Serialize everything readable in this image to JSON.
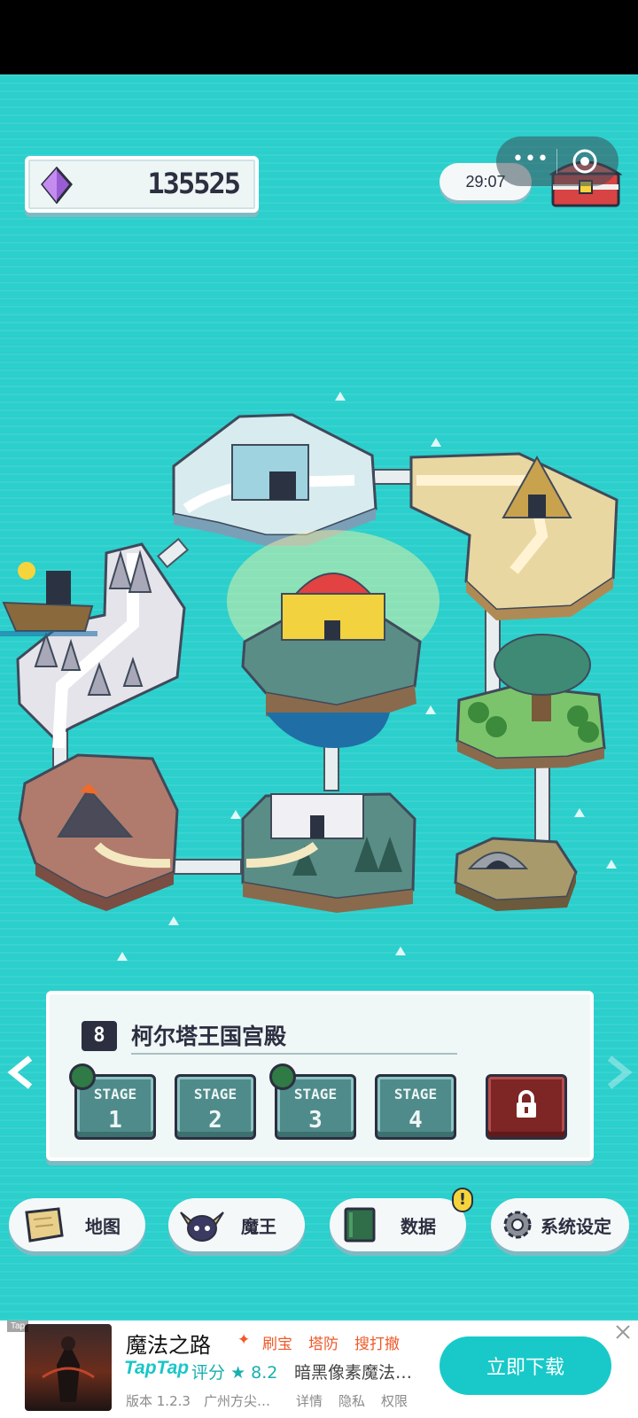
{
  "hud": {
    "gem_icon": "purple-gem-icon",
    "gem_count": "135525",
    "timer": "29:07",
    "more_icon": "more-dots-icon",
    "close_icon": "target-ring-icon",
    "chest_icon": "treasure-chest-icon"
  },
  "stage_panel": {
    "level_number": "8",
    "title": "柯尔塔王国宫殿",
    "stage_word": "STAGE",
    "stages": [
      {
        "num": "1",
        "has_book": true
      },
      {
        "num": "2",
        "has_book": false
      },
      {
        "num": "3",
        "has_book": true
      },
      {
        "num": "4",
        "has_book": false
      }
    ],
    "locked_icon": "lock-icon"
  },
  "nav": {
    "map_label": "地图",
    "demon_label": "魔王",
    "data_label": "数据",
    "data_alert": "!",
    "settings_label": "系统设定"
  },
  "ad": {
    "tag": "Tap",
    "app_name": "魔法之路",
    "chips": [
      "刷宝",
      "塔防",
      "搜打撤"
    ],
    "chip_icon": "sparkle-icon",
    "logo": "TapTap",
    "rating_label": "评分",
    "rating_value": "8.2",
    "description": "暗黑像素魔法…",
    "version": "版本 1.2.3",
    "developer": "广州方尖…",
    "link_details": "详情",
    "link_privacy": "隐私",
    "link_permissions": "权限",
    "cta": "立即下载"
  },
  "colors": {
    "sea": "#2bcfcc",
    "panel": "#f0f7f7",
    "stage_button": "#4f8b8a",
    "locked_button": "#7e2525",
    "ink": "#2b2f40",
    "cta": "#19c9c9"
  }
}
